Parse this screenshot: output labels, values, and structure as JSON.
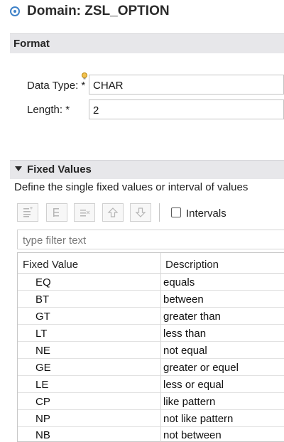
{
  "header": {
    "title": "Domain: ZSL_OPTION",
    "icon": "domain-icon"
  },
  "format": {
    "title": "Format",
    "data_type_label": "Data Type: *",
    "data_type_value": "CHAR",
    "length_label": "Length: *",
    "length_value": "2"
  },
  "fixed_values": {
    "title": "Fixed Values",
    "description": "Define the single fixed values or interval of values",
    "toolbar": [
      "add-value-icon",
      "insert-value-icon",
      "remove-value-icon",
      "move-up-icon",
      "move-down-icon"
    ],
    "intervals_label": "Intervals",
    "intervals_checked": false,
    "filter_placeholder": "type filter text",
    "columns": [
      "Fixed Value",
      "Description"
    ],
    "rows": [
      {
        "value": "EQ",
        "description": "equals"
      },
      {
        "value": "BT",
        "description": "between"
      },
      {
        "value": "GT",
        "description": "greater than"
      },
      {
        "value": "LT",
        "description": "less than"
      },
      {
        "value": "NE",
        "description": "not equal"
      },
      {
        "value": "GE",
        "description": "greater or equel"
      },
      {
        "value": "LE",
        "description": "less or equal"
      },
      {
        "value": "CP",
        "description": "like pattern"
      },
      {
        "value": "NP",
        "description": "not like pattern"
      },
      {
        "value": "NB",
        "description": "not between"
      }
    ]
  },
  "colors": {
    "accent": "#3f82c8",
    "section_bg": "#e7e7ea"
  }
}
